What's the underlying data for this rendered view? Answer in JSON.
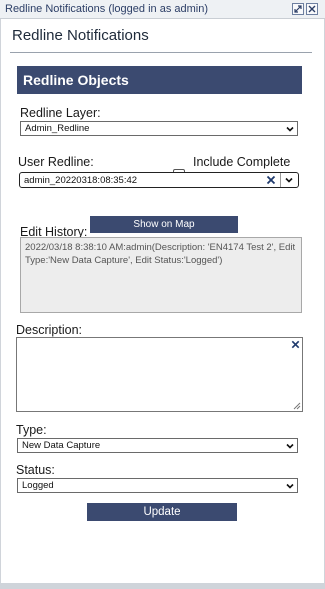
{
  "window": {
    "title": "Redline Notifications (logged in as admin)"
  },
  "panel": {
    "title": "Redline Notifications",
    "section_header": "Redline Objects"
  },
  "form": {
    "layer_label": "Redline Layer:",
    "layer_value": "Admin_Redline",
    "user_redline_label": "User Redline:",
    "include_complete_label": "Include Complete",
    "include_complete_checked": false,
    "user_redline_value": "admin_20220318:08:35:42",
    "show_on_map_label": "Show on Map",
    "edit_history_label": "Edit History:",
    "edit_history_lines": [
      "2022/03/18 8:38:10 AM:admin(Description: 'EN4174 Test 2',  Edit",
      "Type:'New Data Capture',  Edit Status:'Logged')"
    ],
    "description_label": "Description:",
    "description_value": "",
    "type_label": "Type:",
    "type_value": "New Data Capture",
    "status_label": "Status:",
    "status_value": "Logged",
    "update_label": "Update"
  },
  "icons": {
    "maximize": "expand-icon",
    "close": "close-icon",
    "dropdown": "chevron-down-icon",
    "clear": "clear-x-icon",
    "resize": "resize-grip-icon"
  },
  "colors": {
    "accent": "#3b4a70",
    "clear_icon": "#1f3a6d"
  }
}
